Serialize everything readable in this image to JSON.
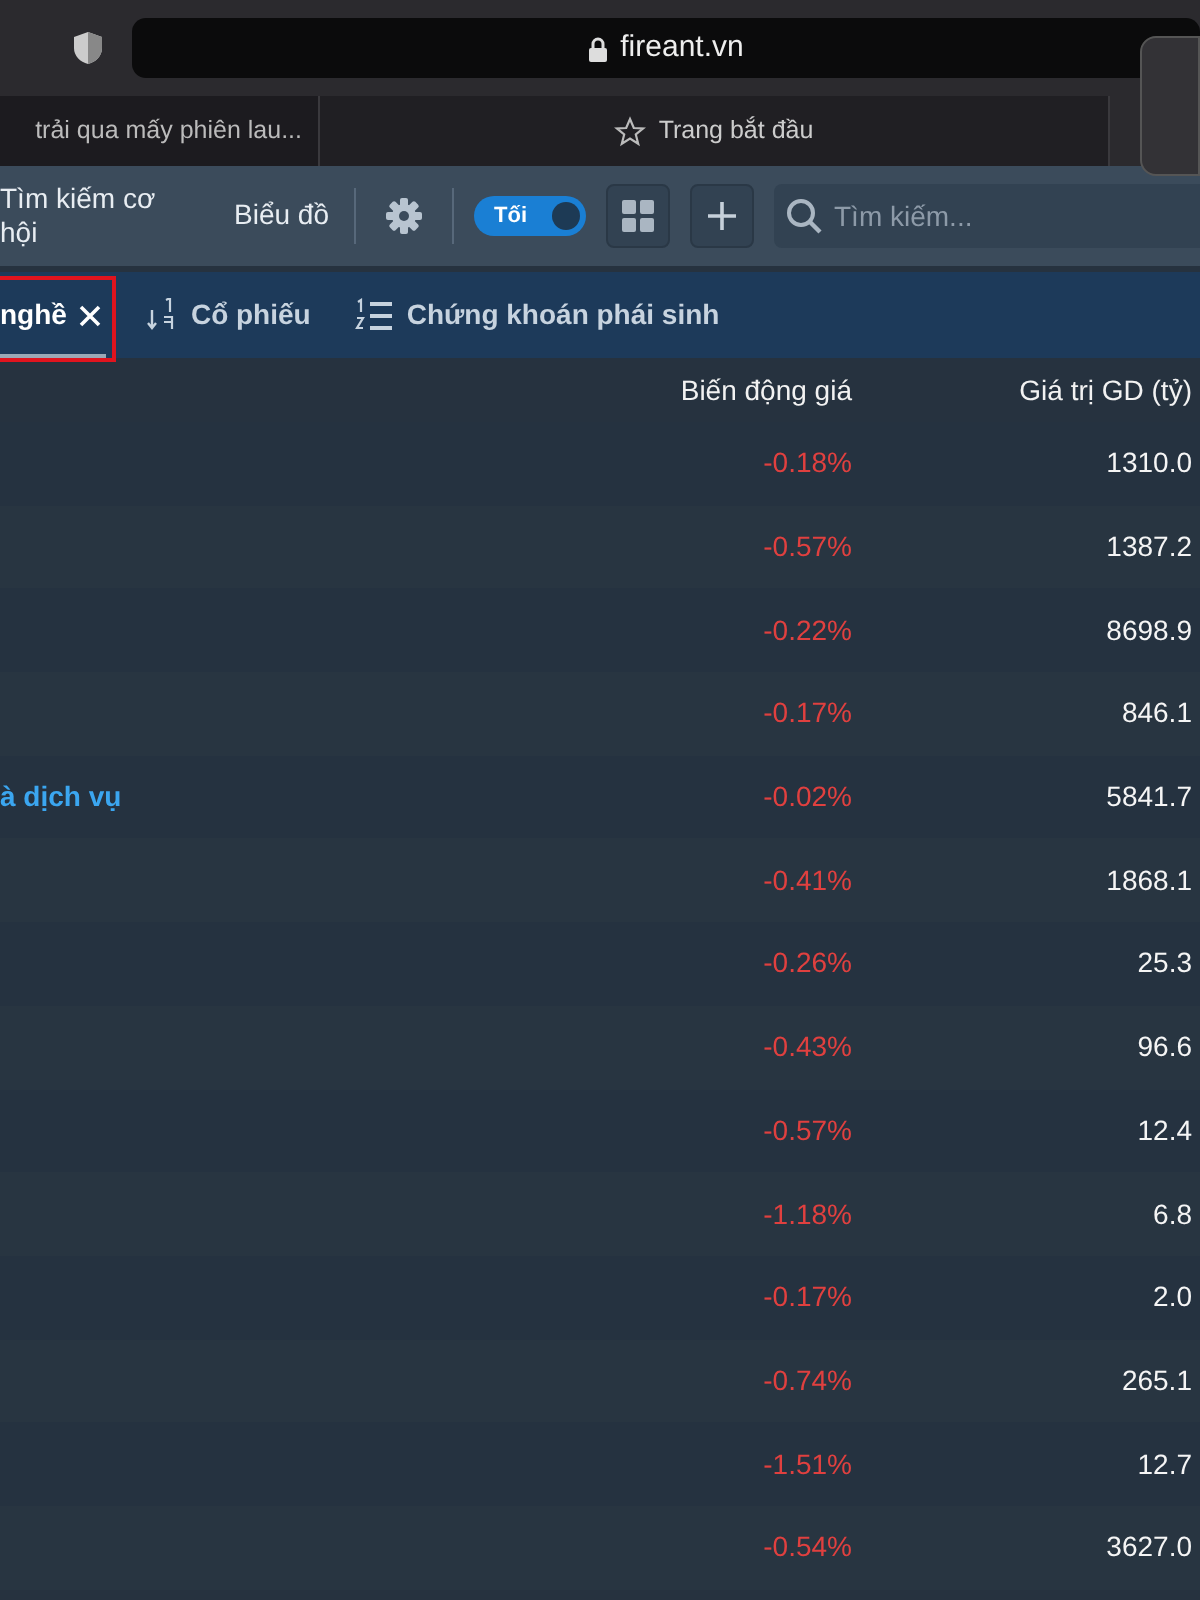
{
  "browser": {
    "url": "fireant.vn",
    "tabs": [
      {
        "label": "trải qua mấy phiên lau...",
        "selected": false
      },
      {
        "label": "Trang bắt đầu",
        "selected": true
      }
    ]
  },
  "nav": {
    "links": [
      "Tìm kiếm cơ hội",
      "Biểu đồ"
    ],
    "theme_toggle": {
      "label": "Tối",
      "on": true
    },
    "search": {
      "placeholder": "Tìm kiếm..."
    }
  },
  "tabs": [
    {
      "label": "nghề",
      "kind": "plain",
      "selected": true,
      "closable": true,
      "highlighted": true
    },
    {
      "label": "Cổ phiếu",
      "kind": "sort",
      "selected": false,
      "closable": false,
      "highlighted": false
    },
    {
      "label": "Chứng khoán phái sinh",
      "kind": "list",
      "selected": false,
      "closable": false,
      "highlighted": false
    }
  ],
  "table": {
    "columns": [
      "Biến động giá",
      "Giá trị GD (tỷ)"
    ],
    "rows": [
      {
        "change": "-0.18%",
        "value": "1310.0"
      },
      {
        "change": "-0.57%",
        "value": "1387.2"
      },
      {
        "change": "-0.22%",
        "value": "8698.9"
      },
      {
        "change": "-0.17%",
        "value": "846.1"
      },
      {
        "name": "à dịch vụ",
        "change": "-0.02%",
        "value": "5841.7"
      },
      {
        "change": "-0.41%",
        "value": "1868.1"
      },
      {
        "change": "-0.26%",
        "value": "25.3"
      },
      {
        "change": "-0.43%",
        "value": "96.6"
      },
      {
        "change": "-0.57%",
        "value": "12.4"
      },
      {
        "change": "-1.18%",
        "value": "6.8"
      },
      {
        "change": "-0.17%",
        "value": "2.0"
      },
      {
        "change": "-0.74%",
        "value": "265.1"
      },
      {
        "change": "-1.51%",
        "value": "12.7"
      },
      {
        "change": "-0.54%",
        "value": "3627.0"
      }
    ]
  }
}
